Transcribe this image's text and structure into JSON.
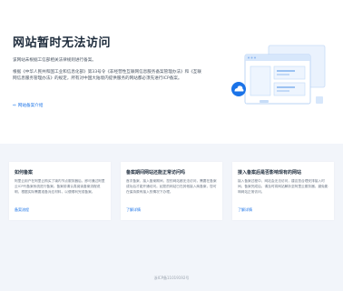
{
  "page": {
    "title": "网站暂时无法访问",
    "para1": "该网站未根据工信部相关法律规则进行备案。",
    "para2": "根据《中华人民共和国工业和信息化部》第33号令《非经营性互联网信息服务备案管理办法》和《互联网信息服务管理办法》的规定，所有对中国大陆境内提供服务的网站都必须先进行ICP备案。",
    "main_link": "网站备案介绍",
    "main_link_arrow": "⇨"
  },
  "cards": [
    {
      "title": "如何备案",
      "body": "阿里云用户在阿里云购买了境内节点服务器后，即可通过阿里云ICP代备案系统进行备案。备案前请认真阅读备案流程说明，根据实际需要准备对应材料，以便顺利完成备案。",
      "link": "备案流程"
    },
    {
      "title": "备案期间网站还能正常访问吗",
      "body": "首次备案、接入备案期间，您的网站都无法访问，需要在备案成功后才能开通访问。如您的网站已在其他接入商备案，您可在保持原有接入的情况下办理。",
      "link": "了解详情"
    },
    {
      "title": "接入备案后是否影响现有的网站",
      "body": "接入备案过程中，网站会无法访问，建议您合理安排接入时间。备案完成后，请及时将网站解析至阿里云服务器，避免影响网站正常访问。",
      "link": "了解详情"
    }
  ],
  "footer": {
    "text": "浙ICP备11019192号"
  },
  "colors": {
    "accent": "#1a73e8",
    "bottom_bg": "#f2f5fa",
    "title": "#1f2d3d"
  }
}
